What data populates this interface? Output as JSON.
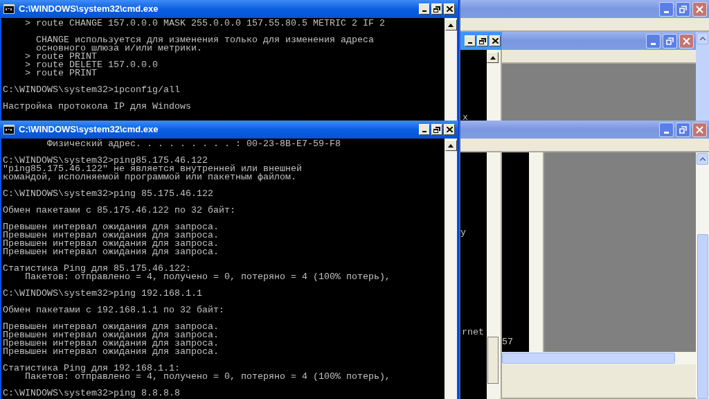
{
  "consoles": [
    {
      "title": "C:\\WINDOWS\\system32\\cmd.exe",
      "blocks": [
        [
          "    > route CHANGE 157.0.0.0 MASK 255.0.0.0 157.55.80.5 METRIC 2 IF 2"
        ],
        [
          "      CHANGE используется для изменения только для изменения адреса",
          "      основного шлюза и/или метрики.",
          "    > route PRINT",
          "    > route DELETE 157.0.0.0",
          "    > route PRINT"
        ],
        [
          "C:\\WINDOWS\\system32>ipconfig/all"
        ],
        [
          "Настройка протокола IP для Windows"
        ]
      ]
    },
    {
      "title": "C:\\WINDOWS\\system32\\cmd.exe",
      "blocks": [
        [
          "        Физический адрес. . . . . . . . . : 00-23-8B-E7-59-F8"
        ],
        [
          "C:\\WINDOWS\\system32>ping85.175.46.122",
          "\"ping85.175.46.122\" не является внутренней или внешней",
          "командой, исполняемой программой или пакетным файлом."
        ],
        [
          "C:\\WINDOWS\\system32>ping 85.175.46.122"
        ],
        [
          "Обмен пакетами с 85.175.46.122 по 32 байт:"
        ],
        [
          "Превышен интервал ожидания для запроса.",
          "Превышен интервал ожидания для запроса.",
          "Превышен интервал ожидания для запроса.",
          "Превышен интервал ожидания для запроса."
        ],
        [
          "Статистика Ping для 85.175.46.122:",
          "    Пакетов: отправлено = 4, получено = 0, потеряно = 4 (100% потерь),"
        ],
        [
          "C:\\WINDOWS\\system32>ping 192.168.1.1"
        ],
        [
          "Обмен пакетами с 192.168.1.1 по 32 байт:"
        ],
        [
          "Превышен интервал ожидания для запроса.",
          "Превышен интервал ожидания для запроса.",
          "Превышен интервал ожидания для запроса.",
          "Превышен интервал ожидания для запроса."
        ],
        [
          "Статистика Ping для 192.168.1.1:",
          "    Пакетов: отправлено = 4, получено = 0, потеряно = 4 (100% потерь),"
        ],
        [
          "C:\\WINDOWS\\system32>ping 8.8.8.8"
        ]
      ]
    }
  ],
  "background_windows": {
    "top_fragment": "x",
    "bottom_fragments": [
      "y",
      "rnet",
      "57"
    ]
  }
}
